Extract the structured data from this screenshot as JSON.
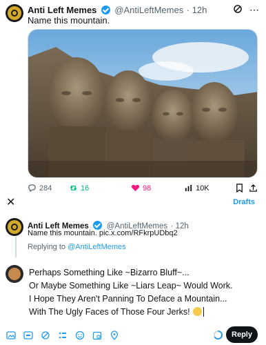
{
  "tweet": {
    "author_name": "Anti Left Memes",
    "author_handle": "@AntiLeftMemes",
    "time": "· 12h",
    "text": "Name this mountain.",
    "stats": {
      "replies": "284",
      "retweets": "16",
      "likes": "98",
      "views": "10K"
    }
  },
  "compose_header": {
    "drafts_label": "Drafts"
  },
  "quoted": {
    "author_name": "Anti Left Memes",
    "author_handle": "@AntiLeftMemes",
    "time": "· 12h",
    "text": "Name this mountain. pic.x.com/RFkrpUDbq2",
    "replying_prefix": "Replying to",
    "replying_handle": "@AntiLeftMemes"
  },
  "reply": {
    "lines": [
      "Perhaps Something Like ~Bizarro Bluff~...",
      "Or Maybe Something Like ~Liars Leap~ Would Work.",
      "I Hope They Aren't Panning To Deface a Mountain...",
      "With The Ugly Faces of Those Four Jerks!"
    ],
    "button_label": "Reply"
  },
  "colors": {
    "accent": "#1d9bf0",
    "retweet_green": "#00ba7c",
    "like_red": "#f91880",
    "text": "#0f1419",
    "muted": "#536471"
  },
  "icons": {
    "toolbar": [
      "image-icon",
      "gif-icon",
      "grok-icon",
      "poll-icon",
      "emoji-icon",
      "schedule-icon",
      "location-icon"
    ]
  }
}
